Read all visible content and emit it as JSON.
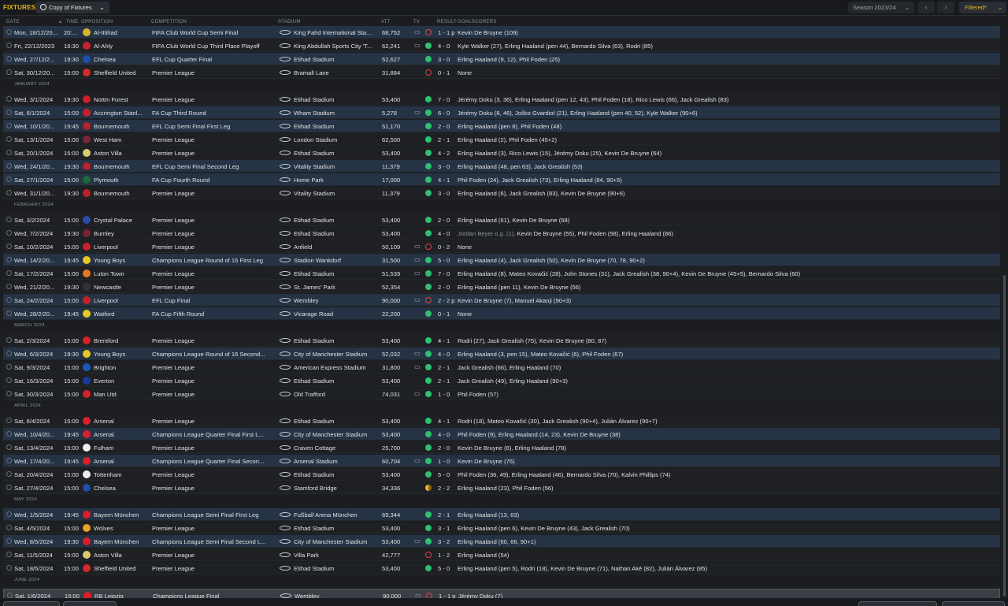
{
  "header": {
    "title": "FIXTURES",
    "view_label": "Copy of Fixtures",
    "season_label": "Season 2023/24",
    "filter_label": "Filtered*"
  },
  "columns": {
    "date": "DATE",
    "time": "TIME",
    "opposition": "OPPOSITION",
    "competition": "COMPETITION",
    "stadium": "STADIUM",
    "att": "ATT",
    "tv": "TV",
    "result": "RESULT",
    "goalscorers": "GOALSCORERS"
  },
  "months": [
    "JANUARY 2024",
    "FEBRUARY 2024",
    "MARCH 2024",
    "APRIL 2024",
    "MAY 2024",
    "JUNE 2024"
  ],
  "fixtures": [
    {
      "date": "Mon, 18/12/20...",
      "time": "20:...",
      "opp": "Al-Ittihad",
      "comp": "FIFA Club World Cup Semi Final",
      "stadium": "King Fahd International Sta...",
      "att": "68,752",
      "tv": "▭",
      "res": "l",
      "score": "1 - 1 p",
      "goals": "Kevin De Bruyne (109)",
      "crest": "#d8b42a",
      "hl": true
    },
    {
      "date": "Fri, 22/12/2023",
      "time": "16:30",
      "opp": "Al-Ahly",
      "comp": "FIFA Club World Cup Third Place Playoff",
      "stadium": "King Abdullah Sports City 'T...",
      "att": "62,241",
      "tv": "▭",
      "res": "w",
      "score": "4 - 0",
      "goals": "Kyle Walker (27), Erling Haaland (pen 44), Bernardo Silva (63), Rodri (85)",
      "crest": "#c8202a",
      "hl": false
    },
    {
      "date": "Wed, 27/12/2...",
      "time": "19:30",
      "opp": "Chelsea",
      "comp": "EFL Cup Quarter Final",
      "stadium": "Etihad Stadium",
      "att": "52,627",
      "tv": "",
      "res": "w",
      "score": "3 - 0",
      "goals": "Erling Haaland (9, 12), Phil Foden (25)",
      "crest": "#1f4fa8",
      "hl": true
    },
    {
      "date": "Sat, 30/12/20...",
      "time": "15:00",
      "opp": "Sheffield United",
      "comp": "Premier League",
      "stadium": "Bramall Lane",
      "att": "31,884",
      "tv": "",
      "res": "l",
      "score": "0 - 1",
      "goals": "None",
      "crest": "#d22a2a",
      "hl": false
    },
    {
      "date": "Wed, 3/1/2024",
      "time": "19:30",
      "opp": "Nottm Forest",
      "comp": "Premier League",
      "stadium": "Etihad Stadium",
      "att": "53,400",
      "tv": "",
      "res": "w",
      "score": "7 - 0",
      "goals": "Jérémy Doku (3, 36), Erling Haaland (pen 12, 43), Phil Foden (18), Rico Lewis (66), Jack Grealish (83)",
      "crest": "#c8202a",
      "hl": false
    },
    {
      "date": "Sat, 6/1/2024",
      "time": "15:00",
      "opp": "Accrington Stanl...",
      "comp": "FA Cup Third Round",
      "stadium": "Wham Stadium",
      "att": "5,278",
      "tv": "▭",
      "res": "w",
      "score": "6 - 0",
      "goals": "Jérémy Doku (8, 46), Joško Gvardiol (21), Erling Haaland (pen 40, 52), Kyle Walker (90+6)",
      "crest": "#c8202a",
      "hl": true
    },
    {
      "date": "Wed, 10/1/20...",
      "time": "19:45",
      "opp": "Bournemouth",
      "comp": "EFL Cup Semi Final First Leg",
      "stadium": "Etihad Stadium",
      "att": "51,170",
      "tv": "",
      "res": "w",
      "score": "2 - 0",
      "goals": "Erling Haaland (pen 8), Phil Foden (48)",
      "crest": "#b8202a",
      "hl": true
    },
    {
      "date": "Sat, 13/1/2024",
      "time": "15:00",
      "opp": "West Ham",
      "comp": "Premier League",
      "stadium": "London Stadium",
      "att": "62,500",
      "tv": "",
      "res": "w",
      "score": "2 - 1",
      "goals": "Erling Haaland (2), Phil Foden (45+2)",
      "crest": "#7a2434",
      "hl": false
    },
    {
      "date": "Sat, 20/1/2024",
      "time": "15:00",
      "opp": "Aston Villa",
      "comp": "Premier League",
      "stadium": "Etihad Stadium",
      "att": "53,400",
      "tv": "",
      "res": "w",
      "score": "4 - 2",
      "goals": "Erling Haaland (3), Rico Lewis (15), Jérémy Doku (25), Kevin De Bruyne (64)",
      "crest": "#d8c870",
      "hl": false
    },
    {
      "date": "Wed, 24/1/20...",
      "time": "19:30",
      "opp": "Bournemouth",
      "comp": "EFL Cup Semi Final Second Leg",
      "stadium": "Vitality Stadium",
      "att": "11,379",
      "tv": "",
      "res": "w",
      "score": "3 - 0",
      "goals": "Erling Haaland (48, pen 63), Jack Grealish (53)",
      "crest": "#b8202a",
      "hl": true
    },
    {
      "date": "Sat, 27/1/2024",
      "time": "15:00",
      "opp": "Plymouth",
      "comp": "FA Cup Fourth Round",
      "stadium": "Home Park",
      "att": "17,000",
      "tv": "",
      "res": "w",
      "score": "4 - 1",
      "goals": "Phil Foden (24), Jack Grealish (73), Erling Haaland (84, 90+5)",
      "crest": "#1a6a3a",
      "hl": true
    },
    {
      "date": "Wed, 31/1/20...",
      "time": "19:30",
      "opp": "Bournemouth",
      "comp": "Premier League",
      "stadium": "Vitality Stadium",
      "att": "11,379",
      "tv": "",
      "res": "w",
      "score": "3 - 0",
      "goals": "Erling Haaland (6), Jack Grealish (83), Kevin De Bruyne (90+6)",
      "crest": "#b8202a",
      "hl": false
    },
    {
      "date": "Sat, 3/2/2024",
      "time": "15:00",
      "opp": "Crystal Palace",
      "comp": "Premier League",
      "stadium": "Etihad Stadium",
      "att": "53,400",
      "tv": "",
      "res": "w",
      "score": "2 - 0",
      "goals": "Erling Haaland (61), Kevin De Bruyne (68)",
      "crest": "#2a4aa8",
      "hl": false
    },
    {
      "date": "Wed, 7/2/2024",
      "time": "19:30",
      "opp": "Burnley",
      "comp": "Premier League",
      "stadium": "Etihad Stadium",
      "att": "53,400",
      "tv": "",
      "res": "w",
      "score": "4 - 0",
      "goals": "",
      "og": "Jordan Beyer o.g. (1),",
      "goals2": " Kevin De Bruyne (55), Phil Foden (58), Erling Haaland (86)",
      "crest": "#7a2434",
      "hl": false
    },
    {
      "date": "Sat, 10/2/2024",
      "time": "15:00",
      "opp": "Liverpool",
      "comp": "Premier League",
      "stadium": "Anfield",
      "att": "50,109",
      "tv": "▭",
      "res": "l",
      "score": "0 - 2",
      "goals": "None",
      "crest": "#c8202a",
      "hl": false
    },
    {
      "date": "Wed, 14/2/20...",
      "time": "19:45",
      "opp": "Young Boys",
      "comp": "Champions League Round of 16 First Leg",
      "stadium": "Stadion Wankdorf",
      "att": "31,500",
      "tv": "▭",
      "res": "w",
      "score": "5 - 0",
      "goals": "Erling Haaland (4), Jack Grealish (50), Kevin De Bruyne (70, 78, 90+2)",
      "crest": "#e8c820",
      "hl": true
    },
    {
      "date": "Sat, 17/2/2024",
      "time": "15:00",
      "opp": "Luton Town",
      "comp": "Premier League",
      "stadium": "Etihad Stadium",
      "att": "51,539",
      "tv": "▭",
      "res": "w",
      "score": "7 - 0",
      "goals": "Erling Haaland (8), Mateo Kovačić (28), John Stones (31), Jack Grealish (38, 90+4), Kevin De Bruyne (45+5), Bernardo Silva (60)",
      "crest": "#e87820",
      "hl": false
    },
    {
      "date": "Wed, 21/2/20...",
      "time": "19:30",
      "opp": "Newcastle",
      "comp": "Premier League",
      "stadium": "St. James' Park",
      "att": "52,354",
      "tv": "",
      "res": "w",
      "score": "2 - 0",
      "goals": "Erling Haaland (pen 11), Kevin De Bruyne (56)",
      "crest": "#333333",
      "hl": false
    },
    {
      "date": "Sat, 24/2/2024",
      "time": "15:00",
      "opp": "Liverpool",
      "comp": "EFL Cup Final",
      "stadium": "Wembley",
      "att": "90,000",
      "tv": "▭",
      "res": "l",
      "score": "2 - 2 p",
      "goals": "Kevin De Bruyne (7), Manuel Akanji (90+3)",
      "crest": "#c8202a",
      "hl": true
    },
    {
      "date": "Wed, 28/2/20...",
      "time": "19:45",
      "opp": "Watford",
      "comp": "FA Cup Fifth Round",
      "stadium": "Vicarage Road",
      "att": "22,200",
      "tv": "",
      "res": "w",
      "score": "0 - 1",
      "goals": "None",
      "crest": "#e8c820",
      "hl": true
    },
    {
      "date": "Sat, 2/3/2024",
      "time": "15:00",
      "opp": "Brentford",
      "comp": "Premier League",
      "stadium": "Etihad Stadium",
      "att": "53,400",
      "tv": "",
      "res": "w",
      "score": "4 - 1",
      "goals": "Rodri (27), Jack Grealish (75), Kevin De Bruyne (80, 87)",
      "crest": "#d8202a",
      "hl": false
    },
    {
      "date": "Wed, 6/3/2024",
      "time": "19:30",
      "opp": "Young Boys",
      "comp": "Champions League Round of 16  Second...",
      "stadium": "City of Manchester Stadium",
      "att": "52,032",
      "tv": "▭",
      "res": "w",
      "score": "4 - 0",
      "goals": "Erling Haaland (3, pen 15), Mateo Kovačić (6), Phil Foden (67)",
      "crest": "#e8c820",
      "hl": true
    },
    {
      "date": "Sat, 9/3/2024",
      "time": "15:00",
      "opp": "Brighton",
      "comp": "Premier League",
      "stadium": "American Express Stadium",
      "att": "31,800",
      "tv": "▭",
      "res": "w",
      "score": "2 - 1",
      "goals": "Jack Grealish (66), Erling Haaland (70)",
      "crest": "#1a5ab8",
      "hl": false
    },
    {
      "date": "Sat, 16/3/2024",
      "time": "15:00",
      "opp": "Everton",
      "comp": "Premier League",
      "stadium": "Etihad Stadium",
      "att": "53,400",
      "tv": "",
      "res": "w",
      "score": "2 - 1",
      "goals": "Jack Grealish (49), Erling Haaland (90+3)",
      "crest": "#1a3a98",
      "hl": false
    },
    {
      "date": "Sat, 30/3/2024",
      "time": "15:00",
      "opp": "Man Utd",
      "comp": "Premier League",
      "stadium": "Old Trafford",
      "att": "74,031",
      "tv": "▭",
      "res": "w",
      "score": "1 - 0",
      "goals": "Phil Foden (57)",
      "crest": "#d8202a",
      "hl": false
    },
    {
      "date": "Sat, 6/4/2024",
      "time": "15:00",
      "opp": "Arsenal",
      "comp": "Premier League",
      "stadium": "Etihad Stadium",
      "att": "53,400",
      "tv": "",
      "res": "w",
      "score": "4 - 1",
      "goals": "Rodri (18), Mateo Kovačić (30), Jack Grealish (90+4), Julián Álvarez (90+7)",
      "crest": "#d8202a",
      "hl": false
    },
    {
      "date": "Wed, 10/4/20...",
      "time": "19:45",
      "opp": "Arsenal",
      "comp": "Champions League Quarter Final First L...",
      "stadium": "City of Manchester Stadium",
      "att": "53,400",
      "tv": "",
      "res": "w",
      "score": "4 - 0",
      "goals": "Phil Foden (9), Erling Haaland (14, 23), Kevin De Bruyne (38)",
      "crest": "#d8202a",
      "hl": true
    },
    {
      "date": "Sat, 13/4/2024",
      "time": "15:00",
      "opp": "Fulham",
      "comp": "Premier League",
      "stadium": "Craven Cottage",
      "att": "25,700",
      "tv": "",
      "res": "w",
      "score": "2 - 0",
      "goals": "Kevin De Bruyne (6), Erling Haaland (78)",
      "crest": "#eeeeee",
      "hl": false
    },
    {
      "date": "Wed, 17/4/20...",
      "time": "19:45",
      "opp": "Arsenal",
      "comp": "Champions League Quarter Final Secon...",
      "stadium": "Arsenal Stadium",
      "att": "60,704",
      "tv": "▭",
      "res": "w",
      "score": "1 - 0",
      "goals": "Kevin De Bruyne (76)",
      "crest": "#d8202a",
      "hl": true
    },
    {
      "date": "Sat, 20/4/2024",
      "time": "15:00",
      "opp": "Tottenham",
      "comp": "Premier League",
      "stadium": "Etihad Stadium",
      "att": "53,400",
      "tv": "",
      "res": "w",
      "score": "5 - 0",
      "goals": "Phil Foden (36, 49), Erling Haaland (46), Bernardo Silva (70), Kalvin Phillips (74)",
      "crest": "#eeeeee",
      "hl": false
    },
    {
      "date": "Sat, 27/4/2024",
      "time": "15:00",
      "opp": "Chelsea",
      "comp": "Premier League",
      "stadium": "Stamford Bridge",
      "att": "34,336",
      "tv": "",
      "res": "d",
      "score": "2 - 2",
      "goals": "Erling Haaland (23), Phil Foden (56)",
      "crest": "#1f4fa8",
      "hl": false
    },
    {
      "date": "Wed, 1/5/2024",
      "time": "19:45",
      "opp": "Bayern München",
      "comp": "Champions League Semi Final First Leg",
      "stadium": "Fußball Arena München",
      "att": "69,344",
      "tv": "",
      "res": "w",
      "score": "2 - 1",
      "goals": "Erling Haaland (13, 63)",
      "crest": "#d8202a",
      "hl": true
    },
    {
      "date": "Sat, 4/5/2024",
      "time": "15:00",
      "opp": "Wolves",
      "comp": "Premier League",
      "stadium": "Etihad Stadium",
      "att": "53,400",
      "tv": "",
      "res": "w",
      "score": "3 - 1",
      "goals": "Erling Haaland (pen 6), Kevin De Bruyne (43), Jack Grealish (70)",
      "crest": "#e8a020",
      "hl": false
    },
    {
      "date": "Wed, 8/5/2024",
      "time": "19:30",
      "opp": "Bayern München",
      "comp": "Champions League Semi Final Second L...",
      "stadium": "City of Manchester Stadium",
      "att": "53,400",
      "tv": "▭",
      "res": "w",
      "score": "3 - 2",
      "goals": "Erling Haaland (60, 66, 90+1)",
      "crest": "#d8202a",
      "hl": true
    },
    {
      "date": "Sat, 11/5/2024",
      "time": "15:00",
      "opp": "Aston Villa",
      "comp": "Premier League",
      "stadium": "Villa Park",
      "att": "42,777",
      "tv": "",
      "res": "l",
      "score": "1 - 2",
      "goals": "Erling Haaland (54)",
      "crest": "#d8c870",
      "hl": false
    },
    {
      "date": "Sat, 18/5/2024",
      "time": "15:00",
      "opp": "Sheffield United",
      "comp": "Premier League",
      "stadium": "Etihad Stadium",
      "att": "53,400",
      "tv": "",
      "res": "w",
      "score": "5 - 0",
      "goals": "Erling Haaland (pen 5), Rodri (18), Kevin De Bruyne (71), Nathan Aké (82), Julián Álvarez (85)",
      "crest": "#d22a2a",
      "hl": false
    },
    {
      "date": "Sat, 1/6/2024",
      "time": "15:00",
      "opp": "RB Leipzig",
      "comp": "Champions League Final",
      "stadium": "Wembley",
      "att": "90,000",
      "tv": "▭",
      "res": "l",
      "score": "1 - 1 p",
      "goals": "Jérémy Doku (7)",
      "crest": "#d8202a",
      "hl": false,
      "cur": true
    }
  ]
}
